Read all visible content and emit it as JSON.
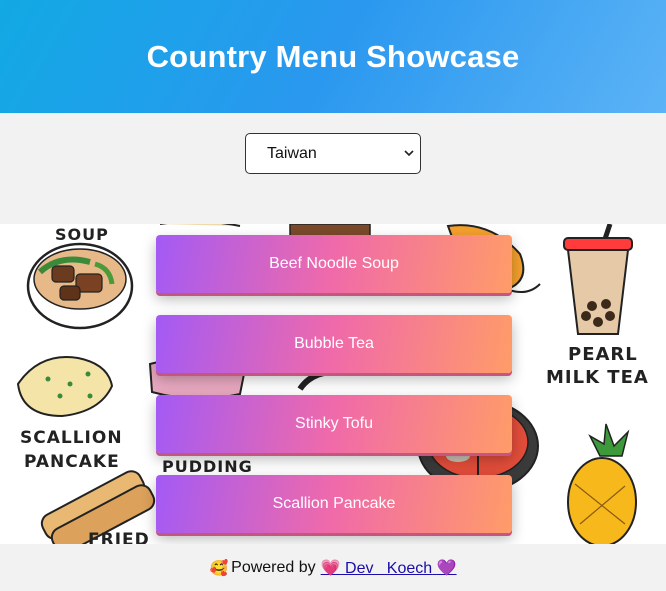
{
  "header": {
    "title": "Country Menu Showcase"
  },
  "country_select": {
    "selected": "Taiwan"
  },
  "artwork": {
    "labels": [
      "SOUP",
      "PEARL",
      "MILK TEA",
      "SCALLION",
      "PANCAKE",
      "PUDDING",
      "FRIED"
    ]
  },
  "dishes": [
    {
      "label": "Beef Noodle Soup"
    },
    {
      "label": "Bubble Tea"
    },
    {
      "label": "Stinky Tofu"
    },
    {
      "label": "Scallion Pancake"
    }
  ],
  "footer": {
    "powered_by": "Powered by",
    "author": "Dev   Koech",
    "leading_emoji": "🥰",
    "heart_emoji": "💗",
    "trailing_emoji": "💜"
  },
  "colors": {
    "header_gradient_start": "#12a9e4",
    "header_gradient_end": "#5cb3f6",
    "button_gradient_start": "#a35af5",
    "button_gradient_mid": "#f06aa9",
    "button_gradient_end": "#ff9c68"
  }
}
